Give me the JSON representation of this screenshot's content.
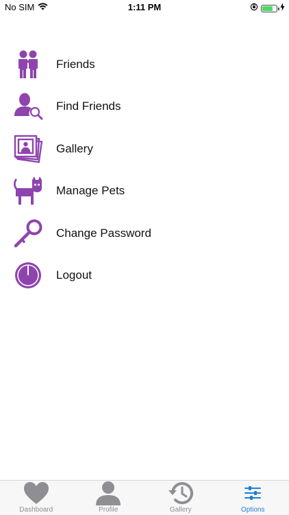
{
  "status_bar": {
    "carrier": "No SIM",
    "time": "1:11 PM"
  },
  "colors": {
    "icon_purple": "#8e44ad",
    "tab_inactive": "#8e8e93",
    "tab_active": "#1a7fd6"
  },
  "menu": {
    "items": [
      {
        "label": "Friends",
        "icon": "friends-icon"
      },
      {
        "label": "Find Friends",
        "icon": "find-friends-icon"
      },
      {
        "label": "Gallery",
        "icon": "gallery-icon"
      },
      {
        "label": "Manage Pets",
        "icon": "cat-icon"
      },
      {
        "label": "Change Password",
        "icon": "key-icon"
      },
      {
        "label": "Logout",
        "icon": "power-icon"
      }
    ]
  },
  "tab_bar": {
    "tabs": [
      {
        "label": "Dashboard",
        "icon": "heart-icon",
        "active": false
      },
      {
        "label": "Profile",
        "icon": "person-icon",
        "active": false
      },
      {
        "label": "Gallery",
        "icon": "history-icon",
        "active": false
      },
      {
        "label": "Options",
        "icon": "sliders-icon",
        "active": true
      }
    ]
  }
}
